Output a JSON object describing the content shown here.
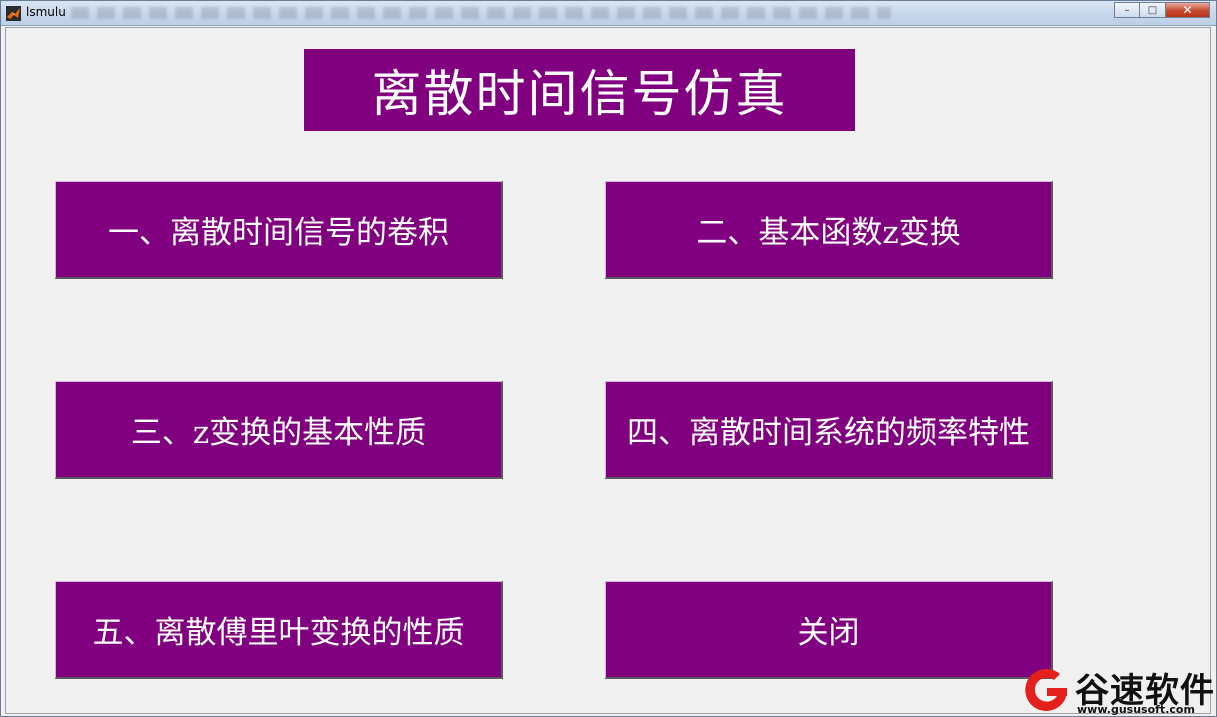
{
  "window": {
    "title": "lsmulu",
    "controls": {
      "minimize": "–",
      "maximize": "□",
      "close": "✕"
    }
  },
  "banner": {
    "title": "离散时间信号仿真"
  },
  "buttons": [
    {
      "label": "一、离散时间信号的卷积"
    },
    {
      "label": "二、基本函数z变换"
    },
    {
      "label": "三、z变换的基本性质"
    },
    {
      "label": "四、离散时间系统的频率特性"
    },
    {
      "label": "五、离散傅里叶变换的性质"
    },
    {
      "label": "关闭"
    }
  ],
  "watermark": {
    "brand": "谷速软件",
    "url": "www.gususoft.com"
  },
  "colors": {
    "button_bg": "#800080",
    "button_text": "#ffffff",
    "window_bg": "#f0f0f0",
    "watermark_red": "#e3201b"
  },
  "icons": {
    "app": "matlab-icon",
    "watermark": "gususoft-logo-icon"
  }
}
